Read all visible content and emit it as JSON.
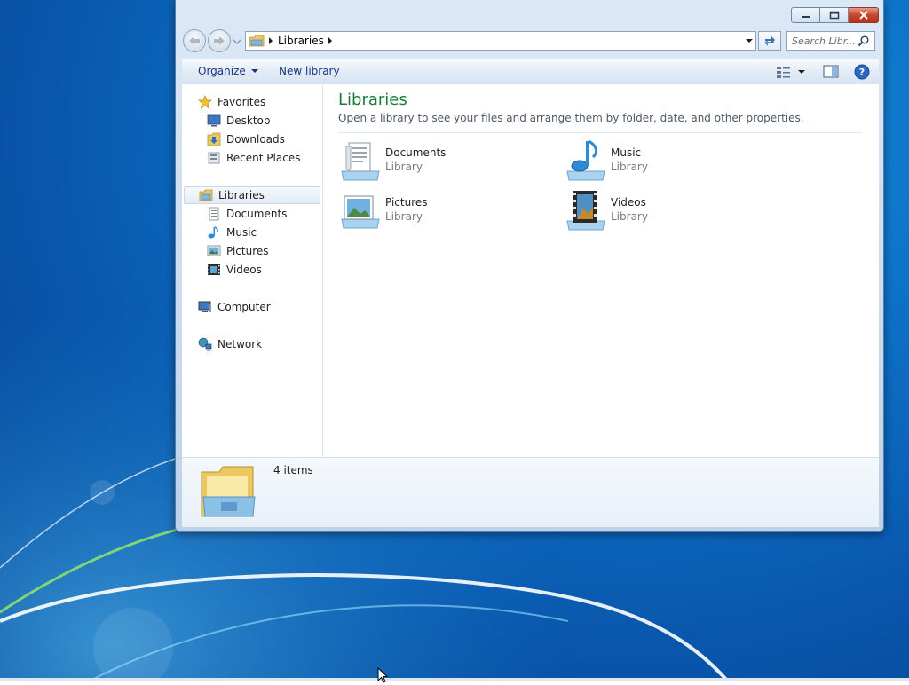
{
  "address": {
    "crumb": "Libraries"
  },
  "search": {
    "placeholder": "Search Libr..."
  },
  "toolbar": {
    "organize": "Organize",
    "new_library": "New library"
  },
  "nav": {
    "favorites": "Favorites",
    "favorites_items": [
      "Desktop",
      "Downloads",
      "Recent Places"
    ],
    "libraries": "Libraries",
    "libraries_items": [
      "Documents",
      "Music",
      "Pictures",
      "Videos"
    ],
    "computer": "Computer",
    "network": "Network"
  },
  "main": {
    "title": "Libraries",
    "subtitle": "Open a library to see your files and arrange them by folder, date, and other properties.",
    "tiles": [
      {
        "name": "Documents",
        "type": "Library"
      },
      {
        "name": "Music",
        "type": "Library"
      },
      {
        "name": "Pictures",
        "type": "Library"
      },
      {
        "name": "Videos",
        "type": "Library"
      }
    ]
  },
  "details": {
    "count": "4 items"
  },
  "colors": {
    "title_green": "#1e7a3a",
    "command_text": "#1e3287",
    "desktop_blue": "#0d72c8"
  }
}
